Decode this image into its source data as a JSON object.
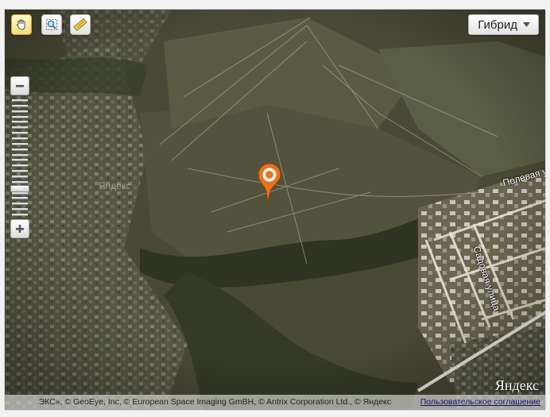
{
  "toolbar": {
    "tools": [
      {
        "name": "hand-tool",
        "icon": "hand-icon",
        "active": true
      },
      {
        "name": "magnifier-tool",
        "icon": "magnifier-icon",
        "active": false
      },
      {
        "name": "ruler-tool",
        "icon": "ruler-icon",
        "active": false
      }
    ]
  },
  "layer_selector": {
    "label": "Гибрид"
  },
  "zoom": {
    "minus_icon": "minus-icon",
    "plus_icon": "plus-icon",
    "level_fraction": 0.78
  },
  "map": {
    "watermark": "Яндекс",
    "streets": [
      "Полевая у",
      "Садовая улица"
    ],
    "marker_color": "#e8741d"
  },
  "footer": {
    "copyright": "ЭКС», © GeoEye, Inc, © European Space Imaging GmBH, © Antrix Corporation Ltd., © Яндекс",
    "terms_link": "Пользовательское соглашение",
    "logo": "Яндекс"
  }
}
